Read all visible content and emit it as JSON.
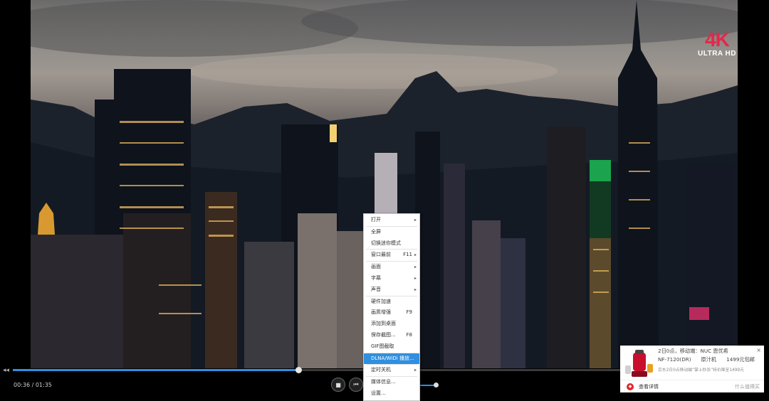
{
  "badge": {
    "resolution": "4K",
    "label": "ULTRA HD"
  },
  "player": {
    "collapse_icon": "◂◂",
    "current_time": "00:36",
    "total_time": "01:35",
    "progress": 0.395,
    "volume": 0.85,
    "stop_icon": "■",
    "prev_icon": "⏮"
  },
  "context_menu": {
    "items": [
      {
        "label": "打开",
        "shortcut": "",
        "submenu": true
      },
      {
        "label": "全屏",
        "shortcut": "",
        "submenu": false
      },
      {
        "label": "切换迷你模式",
        "shortcut": "",
        "submenu": false
      },
      {
        "label": "窗口最前",
        "shortcut": "F11",
        "submenu": true
      },
      {
        "label": "画面",
        "shortcut": "",
        "submenu": true
      },
      {
        "label": "字幕",
        "shortcut": "",
        "submenu": true
      },
      {
        "label": "声音",
        "shortcut": "",
        "submenu": true
      },
      {
        "label": "硬件加速",
        "shortcut": "",
        "submenu": false
      },
      {
        "label": "画质增强",
        "shortcut": "F9",
        "submenu": false
      },
      {
        "label": "添加到桌面",
        "shortcut": "",
        "submenu": false
      },
      {
        "label": "保存截图...",
        "shortcut": "F8",
        "submenu": false
      },
      {
        "label": "GIF图截取",
        "shortcut": "",
        "submenu": false
      },
      {
        "label": "DLNA/WiDi 播放...",
        "shortcut": "",
        "submenu": false,
        "active": true
      },
      {
        "label": "定时关机",
        "shortcut": "",
        "submenu": true
      },
      {
        "label": "媒体信息...",
        "shortcut": "",
        "submenu": false
      },
      {
        "label": "设置...",
        "shortcut": "",
        "submenu": false
      }
    ]
  },
  "ad": {
    "line1": "2日0点，移动端：NUC 恩优希",
    "model": "NF-7120(DR)",
    "product": "原汁机",
    "price": "1499元包邮",
    "line3": "京东2日0点移动端“掌上秒杀”特价降至1499元",
    "detail_label": "查看详情",
    "close_icon": "×",
    "brand": "什么值得买",
    "logo_icon": "jd-logo-icon"
  },
  "colors": {
    "accent": "#2f8fe0",
    "badge_red": "#e8264a"
  }
}
